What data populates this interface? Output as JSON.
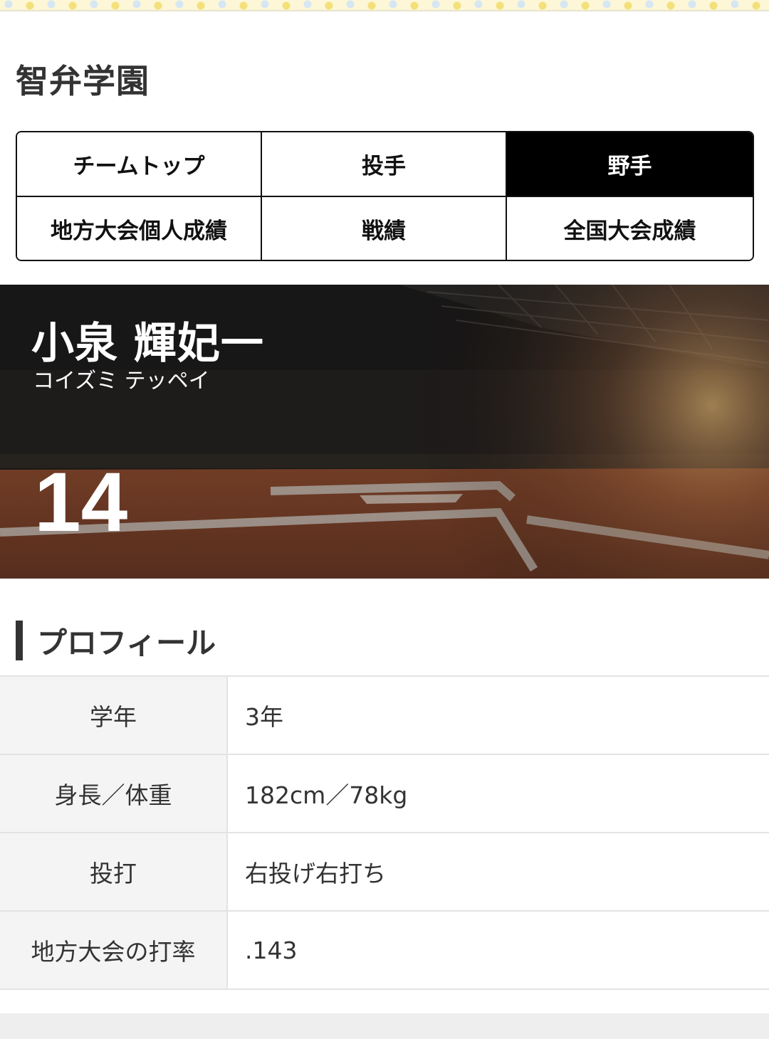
{
  "school": {
    "title": "智弁学園"
  },
  "tabs": [
    {
      "label": "チームトップ",
      "active": false
    },
    {
      "label": "投手",
      "active": false
    },
    {
      "label": "野手",
      "active": true
    },
    {
      "label": "地方大会個人成績",
      "active": false
    },
    {
      "label": "戦績",
      "active": false
    },
    {
      "label": "全国大会成績",
      "active": false
    }
  ],
  "player": {
    "name": "小泉 輝妃一",
    "kana": "コイズミ テッペイ",
    "number": "14"
  },
  "profile": {
    "heading": "プロフィール",
    "rows": [
      {
        "label": "学年",
        "value": "3年"
      },
      {
        "label": "身長／体重",
        "value": "182cm／78kg"
      },
      {
        "label": "投打",
        "value": "右投げ右打ち"
      },
      {
        "label": "地方大会の打率",
        "value": ".143"
      }
    ]
  }
}
